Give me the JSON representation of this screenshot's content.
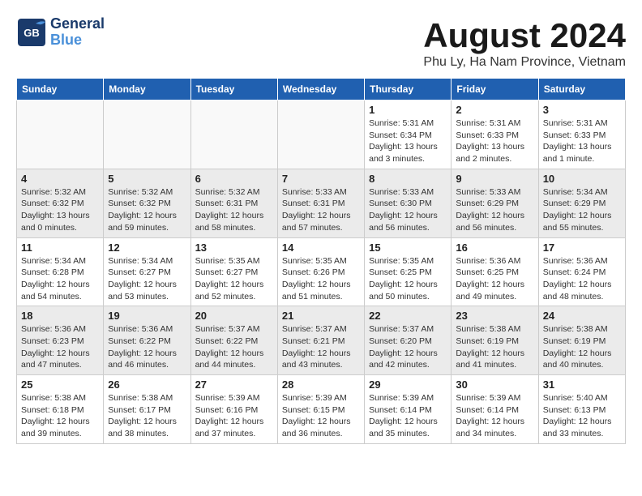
{
  "header": {
    "logo_line1": "General",
    "logo_line2": "Blue",
    "main_title": "August 2024",
    "subtitle": "Phu Ly, Ha Nam Province, Vietnam"
  },
  "calendar": {
    "headers": [
      "Sunday",
      "Monday",
      "Tuesday",
      "Wednesday",
      "Thursday",
      "Friday",
      "Saturday"
    ],
    "weeks": [
      [
        {
          "day": "",
          "info": ""
        },
        {
          "day": "",
          "info": ""
        },
        {
          "day": "",
          "info": ""
        },
        {
          "day": "",
          "info": ""
        },
        {
          "day": "1",
          "info": "Sunrise: 5:31 AM\nSunset: 6:34 PM\nDaylight: 13 hours\nand 3 minutes."
        },
        {
          "day": "2",
          "info": "Sunrise: 5:31 AM\nSunset: 6:33 PM\nDaylight: 13 hours\nand 2 minutes."
        },
        {
          "day": "3",
          "info": "Sunrise: 5:31 AM\nSunset: 6:33 PM\nDaylight: 13 hours\nand 1 minute."
        }
      ],
      [
        {
          "day": "4",
          "info": "Sunrise: 5:32 AM\nSunset: 6:32 PM\nDaylight: 13 hours\nand 0 minutes."
        },
        {
          "day": "5",
          "info": "Sunrise: 5:32 AM\nSunset: 6:32 PM\nDaylight: 12 hours\nand 59 minutes."
        },
        {
          "day": "6",
          "info": "Sunrise: 5:32 AM\nSunset: 6:31 PM\nDaylight: 12 hours\nand 58 minutes."
        },
        {
          "day": "7",
          "info": "Sunrise: 5:33 AM\nSunset: 6:31 PM\nDaylight: 12 hours\nand 57 minutes."
        },
        {
          "day": "8",
          "info": "Sunrise: 5:33 AM\nSunset: 6:30 PM\nDaylight: 12 hours\nand 56 minutes."
        },
        {
          "day": "9",
          "info": "Sunrise: 5:33 AM\nSunset: 6:29 PM\nDaylight: 12 hours\nand 56 minutes."
        },
        {
          "day": "10",
          "info": "Sunrise: 5:34 AM\nSunset: 6:29 PM\nDaylight: 12 hours\nand 55 minutes."
        }
      ],
      [
        {
          "day": "11",
          "info": "Sunrise: 5:34 AM\nSunset: 6:28 PM\nDaylight: 12 hours\nand 54 minutes."
        },
        {
          "day": "12",
          "info": "Sunrise: 5:34 AM\nSunset: 6:27 PM\nDaylight: 12 hours\nand 53 minutes."
        },
        {
          "day": "13",
          "info": "Sunrise: 5:35 AM\nSunset: 6:27 PM\nDaylight: 12 hours\nand 52 minutes."
        },
        {
          "day": "14",
          "info": "Sunrise: 5:35 AM\nSunset: 6:26 PM\nDaylight: 12 hours\nand 51 minutes."
        },
        {
          "day": "15",
          "info": "Sunrise: 5:35 AM\nSunset: 6:25 PM\nDaylight: 12 hours\nand 50 minutes."
        },
        {
          "day": "16",
          "info": "Sunrise: 5:36 AM\nSunset: 6:25 PM\nDaylight: 12 hours\nand 49 minutes."
        },
        {
          "day": "17",
          "info": "Sunrise: 5:36 AM\nSunset: 6:24 PM\nDaylight: 12 hours\nand 48 minutes."
        }
      ],
      [
        {
          "day": "18",
          "info": "Sunrise: 5:36 AM\nSunset: 6:23 PM\nDaylight: 12 hours\nand 47 minutes."
        },
        {
          "day": "19",
          "info": "Sunrise: 5:36 AM\nSunset: 6:22 PM\nDaylight: 12 hours\nand 46 minutes."
        },
        {
          "day": "20",
          "info": "Sunrise: 5:37 AM\nSunset: 6:22 PM\nDaylight: 12 hours\nand 44 minutes."
        },
        {
          "day": "21",
          "info": "Sunrise: 5:37 AM\nSunset: 6:21 PM\nDaylight: 12 hours\nand 43 minutes."
        },
        {
          "day": "22",
          "info": "Sunrise: 5:37 AM\nSunset: 6:20 PM\nDaylight: 12 hours\nand 42 minutes."
        },
        {
          "day": "23",
          "info": "Sunrise: 5:38 AM\nSunset: 6:19 PM\nDaylight: 12 hours\nand 41 minutes."
        },
        {
          "day": "24",
          "info": "Sunrise: 5:38 AM\nSunset: 6:19 PM\nDaylight: 12 hours\nand 40 minutes."
        }
      ],
      [
        {
          "day": "25",
          "info": "Sunrise: 5:38 AM\nSunset: 6:18 PM\nDaylight: 12 hours\nand 39 minutes."
        },
        {
          "day": "26",
          "info": "Sunrise: 5:38 AM\nSunset: 6:17 PM\nDaylight: 12 hours\nand 38 minutes."
        },
        {
          "day": "27",
          "info": "Sunrise: 5:39 AM\nSunset: 6:16 PM\nDaylight: 12 hours\nand 37 minutes."
        },
        {
          "day": "28",
          "info": "Sunrise: 5:39 AM\nSunset: 6:15 PM\nDaylight: 12 hours\nand 36 minutes."
        },
        {
          "day": "29",
          "info": "Sunrise: 5:39 AM\nSunset: 6:14 PM\nDaylight: 12 hours\nand 35 minutes."
        },
        {
          "day": "30",
          "info": "Sunrise: 5:39 AM\nSunset: 6:14 PM\nDaylight: 12 hours\nand 34 minutes."
        },
        {
          "day": "31",
          "info": "Sunrise: 5:40 AM\nSunset: 6:13 PM\nDaylight: 12 hours\nand 33 minutes."
        }
      ]
    ]
  }
}
